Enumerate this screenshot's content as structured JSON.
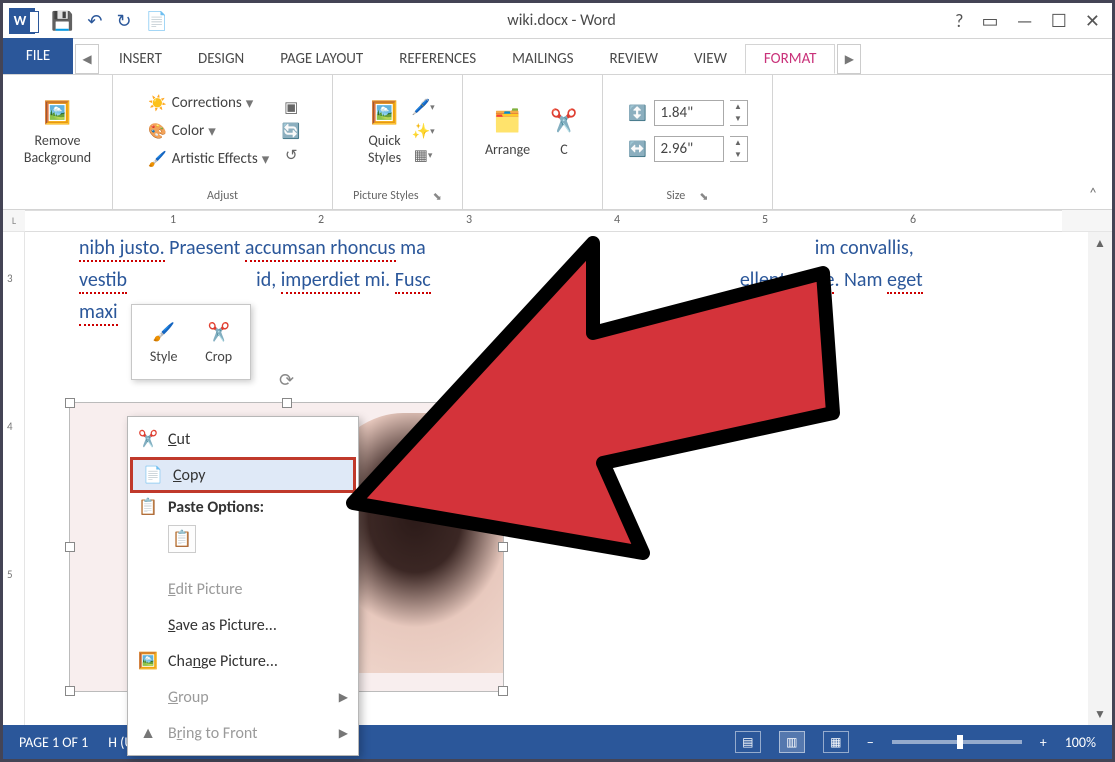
{
  "title": "wiki.docx - Word",
  "qat": {
    "save": "💾",
    "undo": "↶",
    "redo": "↻",
    "touch": "📄"
  },
  "tabs": {
    "file": "FILE",
    "list": [
      "INSERT",
      "DESIGN",
      "PAGE LAYOUT",
      "REFERENCES",
      "MAILINGS",
      "REVIEW",
      "VIEW",
      "FORMAT"
    ],
    "active": "FORMAT"
  },
  "ribbon": {
    "remove_bg": "Remove\nBackground",
    "adjust": {
      "label": "Adjust",
      "corrections": "Corrections",
      "color": "Color",
      "artistic": "Artistic Effects"
    },
    "styles": {
      "label": "Picture Styles",
      "quick": "Quick\nStyles"
    },
    "arrange": {
      "label": "Arrange",
      "btn": "Arrange",
      "crop": "C"
    },
    "size": {
      "label": "Size",
      "h": "1.84\"",
      "w": "2.96\""
    }
  },
  "ruler": {
    "nums": [
      "1",
      "2",
      "3",
      "4",
      "5",
      "6"
    ]
  },
  "vruler": {
    "nums": [
      "3",
      "4",
      "5"
    ]
  },
  "body": {
    "line1a": "nibh justo.",
    "line1b": " Praesent ",
    "line1c": "accumsan rhoncus",
    "line1d": " ma",
    "line1e": "im convallis,",
    "line2a": "vestib",
    "line2b": "id, ",
    "line2c": "imperdiet",
    "line2d": " mi. ",
    "line2e": "Fusc",
    "line2f": "ellentesque",
    "line2g": ". Nam ",
    "line2h": "eget",
    "line3a": "maxi"
  },
  "mini": {
    "style": "Style",
    "crop": "Crop"
  },
  "context": {
    "cut": "Cut",
    "copy": "Copy",
    "paste": "Paste Options:",
    "edit": "Edit Picture",
    "saveas": "Save as Picture...",
    "change": "Change Picture...",
    "group": "Group",
    "front": "Bring to Front"
  },
  "status": {
    "page": "PAGE 1 OF 1",
    "lang": "H (UNITED STATES)",
    "zoom": "100%"
  }
}
